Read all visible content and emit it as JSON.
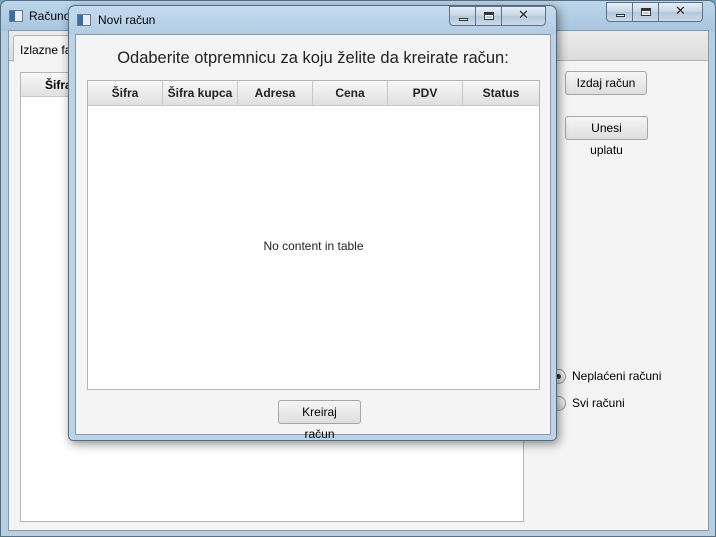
{
  "main_window": {
    "title": "Računo",
    "tab_label": "Izlazne fa",
    "table_column_sifra": "Šifra",
    "buttons": {
      "issue_invoice": "Izdaj račun",
      "enter_payment": "Unesi uplatu"
    },
    "filter_options": [
      {
        "label": "Neplaćeni računi",
        "selected": true
      },
      {
        "label": "Svi računi",
        "selected": false
      }
    ]
  },
  "dialog": {
    "title": "Novi račun",
    "heading": "Odaberite otpremnicu za koju želite da kreirate račun:",
    "columns": [
      "Šifra",
      "Šifra kupca",
      "Adresa",
      "Cena",
      "PDV",
      "Status"
    ],
    "rows": [],
    "empty_placeholder": "No content in table",
    "create_button": "Kreiraj račun"
  },
  "colors": {
    "title_bar": "#bcd6ea",
    "desktop": "#6fa7c9",
    "client": "#f4f4f4"
  },
  "icons": [
    "app-icon",
    "minimize-icon",
    "maximize-icon",
    "close-icon"
  ]
}
